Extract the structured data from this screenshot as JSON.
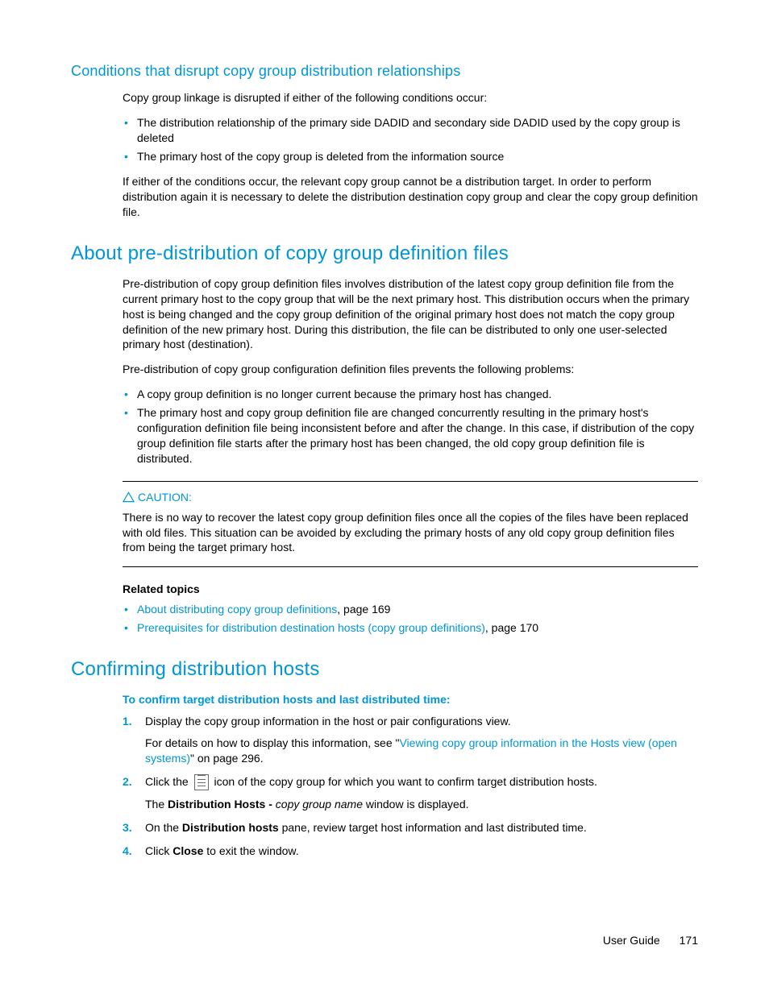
{
  "section1": {
    "heading": "Conditions that disrupt copy group distribution relationships",
    "intro": "Copy group linkage is disrupted if either of the following conditions occur:",
    "bullets": [
      "The distribution relationship of the primary side DADID and secondary side DADID used by the copy group is deleted",
      "The primary host of the copy group is deleted from the information source"
    ],
    "closing": "If either of the conditions occur, the relevant copy group cannot be a distribution target. In order to perform distribution again it is necessary to delete the distribution destination copy group and clear the copy group definition file."
  },
  "section2": {
    "heading": "About pre-distribution of copy group definition files",
    "p1": "Pre-distribution of copy group definition files involves distribution of the latest copy group definition file from the current primary host to the copy group that will be the next primary host. This distribution occurs when the primary host is being changed and the copy group definition of the original primary host does not match the copy group definition of the new primary host. During this distribution, the file can be distributed to only one user-selected primary host (destination).",
    "p2": "Pre-distribution of copy group configuration definition files prevents the following problems:",
    "bullets": [
      "A copy group definition is no longer current because the primary host has changed.",
      "The primary host and copy group definition file are changed concurrently resulting in the primary host's configuration definition file being inconsistent before and after the change. In this case, if distribution of the copy group definition file starts after the primary host has been changed, the old copy group definition file is distributed."
    ],
    "caution_label": "CAUTION:",
    "caution_text": "There is no way to recover the latest copy group definition files once all the copies of the files have been replaced with old files. This situation can be avoided by excluding the primary hosts of any old copy group definition files from being the target primary host.",
    "related_heading": "Related topics",
    "related": [
      {
        "link": "About distributing copy group definitions",
        "suffix": ", page 169"
      },
      {
        "link": "Prerequisites for distribution destination hosts (copy group definitions)",
        "suffix": ", page 170"
      }
    ]
  },
  "section3": {
    "heading": "Confirming distribution hosts",
    "proc_heading": "To confirm target distribution hosts and last distributed time:",
    "step1": {
      "num": "1.",
      "text": "Display the copy group information in the host or pair configurations view.",
      "sub_prefix": "For details on how to display this information, see \"",
      "sub_link": "Viewing copy group information in the Hosts view (open systems)",
      "sub_suffix": "\" on page 296."
    },
    "step2": {
      "num": "2.",
      "prefix": "Click the ",
      "suffix": " icon of the copy group for which you want to confirm target distribution hosts.",
      "sub_pre": "The ",
      "sub_bold": "Distribution Hosts - ",
      "sub_italic": "copy group name",
      "sub_post": " window is displayed."
    },
    "step3": {
      "num": "3.",
      "pre": "On the ",
      "bold": "Distribution hosts",
      "post": " pane, review target host information and last distributed time."
    },
    "step4": {
      "num": "4.",
      "pre": "Click ",
      "bold": "Close",
      "post": " to exit the window."
    }
  },
  "footer": {
    "label": "User Guide",
    "page": "171"
  }
}
